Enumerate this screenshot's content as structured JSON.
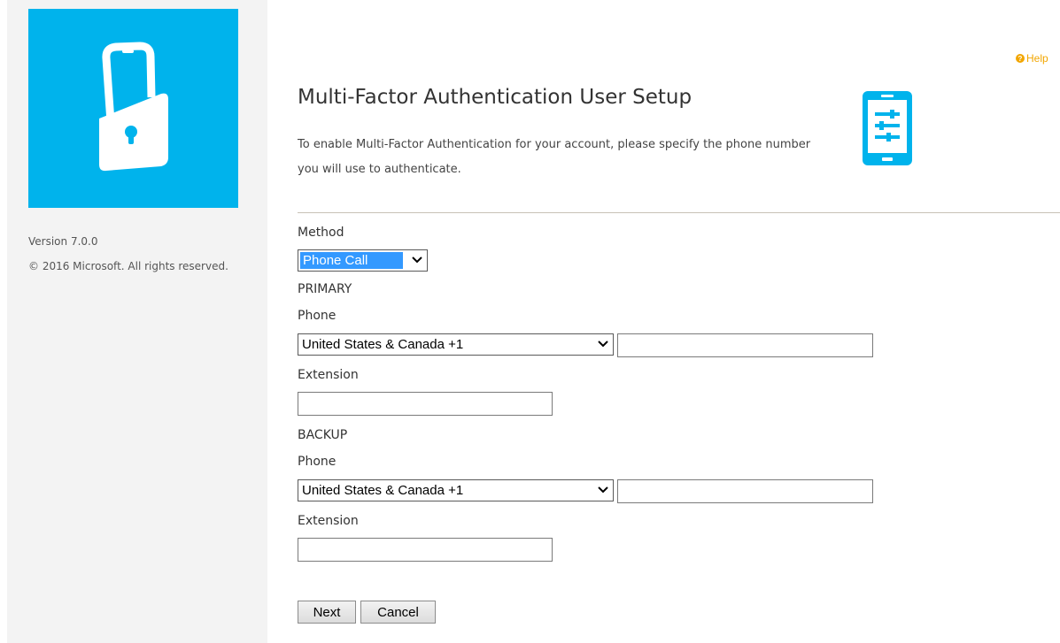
{
  "sidebar": {
    "version": "Version 7.0.0",
    "copyright": "© 2016 Microsoft. All rights reserved."
  },
  "header": {
    "help_label": "Help",
    "help_icon": "help-question-icon",
    "title": "Multi-Factor Authentication User Setup",
    "description": "To enable Multi-Factor Authentication for your account, please specify the phone number you will use to authenticate."
  },
  "form": {
    "method_label": "Method",
    "method_value": "Phone Call",
    "primary": {
      "section_label": "PRIMARY",
      "phone_label": "Phone",
      "country_value": "United States & Canada +1",
      "phone_value": "",
      "extension_label": "Extension",
      "extension_value": ""
    },
    "backup": {
      "section_label": "BACKUP",
      "phone_label": "Phone",
      "country_value": "United States & Canada +1",
      "phone_value": "",
      "extension_label": "Extension",
      "extension_value": ""
    }
  },
  "buttons": {
    "next": "Next",
    "cancel": "Cancel"
  },
  "colors": {
    "brand_tile": "#00b3ec",
    "help": "#f2a600",
    "selection": "#3399ff"
  }
}
